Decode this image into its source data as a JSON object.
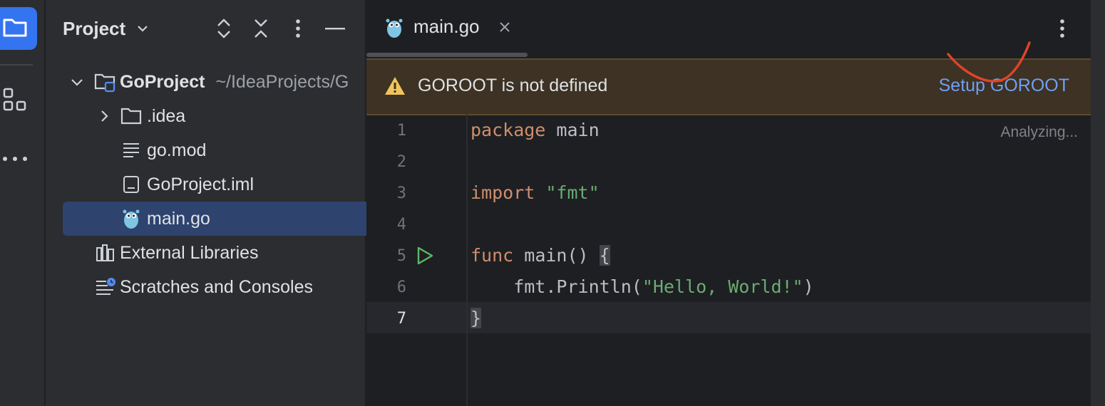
{
  "activity_bar": {
    "items": [
      {
        "icon": "folder-icon",
        "active": true
      },
      {
        "icon": "structure-icon",
        "active": false
      },
      {
        "icon": "more-horizontal-icon",
        "active": false
      }
    ]
  },
  "project_panel": {
    "title": "Project",
    "header_icons": [
      "chevron-down-icon",
      "expand-all-icon",
      "collapse-all-icon",
      "kebab-menu-icon",
      "minimize-icon"
    ],
    "tree": [
      {
        "label": "GoProject",
        "path": "~/IdeaProjects/G",
        "icon": "module-folder-icon",
        "expanded": true
      },
      {
        "label": ".idea",
        "icon": "folder-icon",
        "expanded": false
      },
      {
        "label": "go.mod",
        "icon": "text-file-icon"
      },
      {
        "label": "GoProject.iml",
        "icon": "iml-file-icon"
      },
      {
        "label": "main.go",
        "icon": "gopher-icon",
        "selected": true
      },
      {
        "label": "External Libraries",
        "icon": "libraries-icon"
      },
      {
        "label": "Scratches and Consoles",
        "icon": "scratches-icon"
      }
    ]
  },
  "editor": {
    "tab": {
      "label": "main.go",
      "icon": "gopher-icon"
    },
    "banner": {
      "message": "GOROOT is not defined",
      "action": "Setup GOROOT",
      "icon": "warning-icon"
    },
    "status": "Analyzing...",
    "lines": [
      {
        "n": "1"
      },
      {
        "n": "2"
      },
      {
        "n": "3"
      },
      {
        "n": "4"
      },
      {
        "n": "5"
      },
      {
        "n": "6"
      },
      {
        "n": "7"
      }
    ],
    "code": {
      "l1_kw": "package",
      "l1_rest": " main",
      "l3_kw": "import",
      "l3_str": " \"fmt\"",
      "l5_kw": "func",
      "l5_rest": " main() ",
      "l5_brace": "{",
      "l6_a": "    fmt.Println(",
      "l6_str": "\"Hello, World!\"",
      "l6_b": ")",
      "l7_brace": "}"
    }
  },
  "colors": {
    "accent": "#3574f0",
    "warning_bg": "#3d3223",
    "link": "#6f9ff5",
    "annotation": "#e0442a"
  }
}
